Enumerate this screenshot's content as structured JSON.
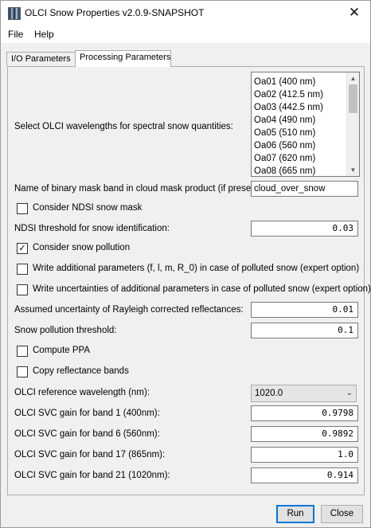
{
  "window": {
    "title": "OLCI Snow Properties v2.0.9-SNAPSHOT",
    "close_glyph": "✕"
  },
  "menu": {
    "items": [
      "File",
      "Help"
    ]
  },
  "tabs": [
    "I/O Parameters",
    "Processing Parameters"
  ],
  "active_tab": "Processing Parameters",
  "form": {
    "wavelengths_label": "Select OLCI wavelengths for spectral snow quantities:",
    "wavelengths": [
      "Oa01 (400 nm)",
      "Oa02 (412.5 nm)",
      "Oa03 (442.5 nm)",
      "Oa04 (490 nm)",
      "Oa05 (510 nm)",
      "Oa06 (560 nm)",
      "Oa07 (620 nm)",
      "Oa08 (665 nm)"
    ],
    "mask_band_label": "Name of binary mask band in cloud mask product (if present):",
    "mask_band_value": "cloud_over_snow",
    "consider_ndsi_label": "Consider NDSI snow mask",
    "consider_ndsi_checked": false,
    "ndsi_threshold_label": "NDSI threshold for snow identification:",
    "ndsi_threshold_value": "0.03",
    "consider_pollution_label": "Consider snow pollution",
    "consider_pollution_checked": true,
    "write_additional_label": "Write additional parameters (f, l, m, R_0) in case of polluted snow (expert option)",
    "write_additional_checked": false,
    "write_uncertainties_label": "Write uncertainties of additional parameters in case of polluted snow (expert option)",
    "write_uncertainties_checked": false,
    "rayleigh_uncertainty_label": "Assumed uncertainty of Rayleigh corrected reflectances:",
    "rayleigh_uncertainty_value": "0.01",
    "pollution_threshold_label": "Snow pollution threshold:",
    "pollution_threshold_value": "0.1",
    "compute_ppa_label": "Compute PPA",
    "compute_ppa_checked": false,
    "copy_reflectance_label": "Copy reflectance bands",
    "copy_reflectance_checked": false,
    "reference_wavelength_label": "OLCI reference wavelength (nm):",
    "reference_wavelength_value": "1020.0",
    "svc_gain_1_label": "OLCI SVC gain for band 1 (400nm):",
    "svc_gain_1_value": "0.9798",
    "svc_gain_6_label": "OLCI SVC gain for band 6 (560nm):",
    "svc_gain_6_value": "0.9892",
    "svc_gain_17_label": "OLCI SVC gain for band 17 (865nm):",
    "svc_gain_17_value": "1.0",
    "svc_gain_21_label": "OLCI SVC gain for band 21 (1020nm):",
    "svc_gain_21_value": "0.914"
  },
  "buttons": {
    "run": "Run",
    "close": "Close"
  },
  "colors": {
    "default_button_border": "#0078d7",
    "panel_bg": "#f0f0f0"
  }
}
